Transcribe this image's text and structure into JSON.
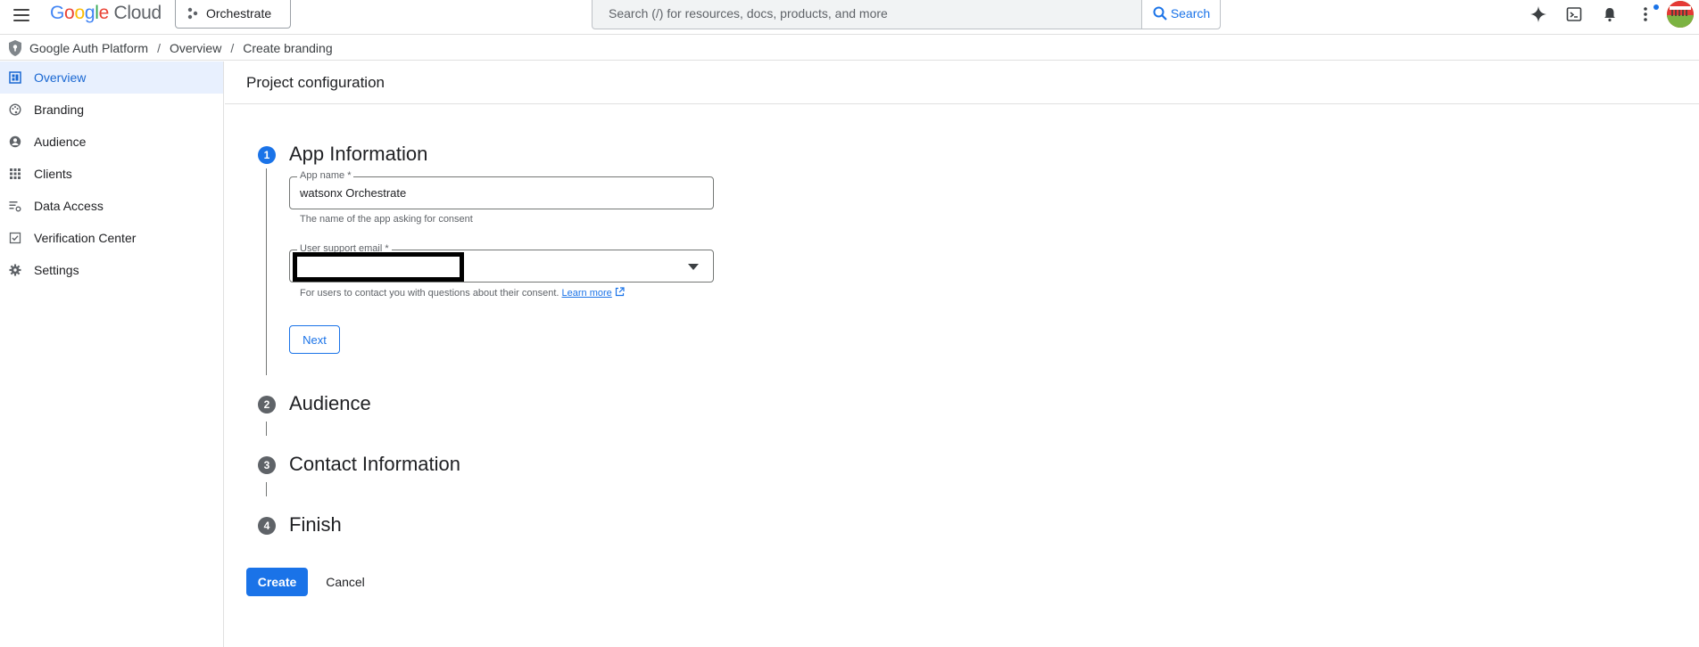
{
  "topbar": {
    "logo_google": "Google",
    "logo_cloud": "Cloud",
    "project_name": "Orchestrate",
    "search_placeholder": "Search (/) for resources, docs, products, and more",
    "search_button": "Search"
  },
  "breadcrumb": {
    "items": [
      "Google Auth Platform",
      "Overview",
      "Create branding"
    ],
    "separator": "/"
  },
  "sidebar": {
    "items": [
      {
        "label": "Overview",
        "icon": "dashboard-icon",
        "active": true
      },
      {
        "label": "Branding",
        "icon": "palette-icon",
        "active": false
      },
      {
        "label": "Audience",
        "icon": "account-circle-icon",
        "active": false
      },
      {
        "label": "Clients",
        "icon": "apps-grid-icon",
        "active": false
      },
      {
        "label": "Data Access",
        "icon": "data-access-icon",
        "active": false
      },
      {
        "label": "Verification Center",
        "icon": "verification-icon",
        "active": false
      },
      {
        "label": "Settings",
        "icon": "gear-icon",
        "active": false
      }
    ]
  },
  "page": {
    "title": "Project configuration"
  },
  "steps": [
    {
      "number": "1",
      "title": "App Information",
      "active": true
    },
    {
      "number": "2",
      "title": "Audience",
      "active": false
    },
    {
      "number": "3",
      "title": "Contact Information",
      "active": false
    },
    {
      "number": "4",
      "title": "Finish",
      "active": false
    }
  ],
  "form": {
    "app_name_label": "App name *",
    "app_name_value": "watsonx Orchestrate",
    "app_name_helper": "The name of the app asking for consent",
    "email_label": "User support email *",
    "email_helper": "For users to contact you with questions about their consent.",
    "learn_more": "Learn more",
    "next_button": "Next"
  },
  "actions": {
    "create": "Create",
    "cancel": "Cancel"
  },
  "colors": {
    "accent": "#1a73e8",
    "active_nav_bg": "#e8f0fe",
    "step_inactive": "#5f6368"
  }
}
